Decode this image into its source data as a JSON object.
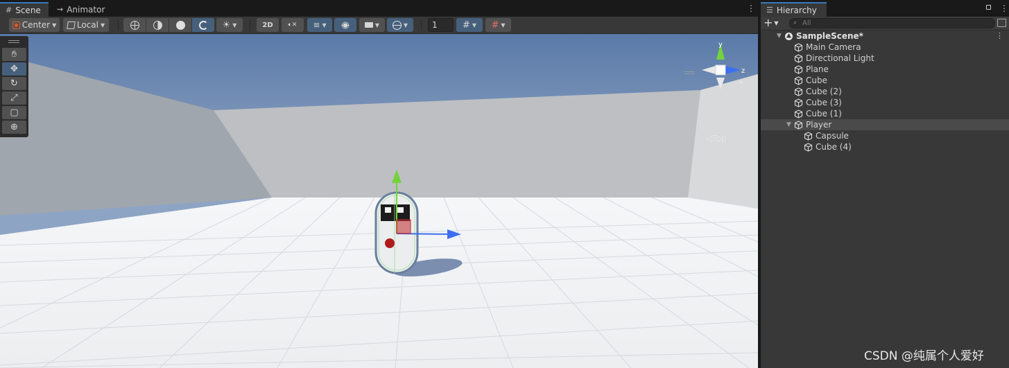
{
  "scene_tabs": {
    "scene_label": "Scene",
    "animator_label": "Animator",
    "menu_glyph": "⋮"
  },
  "hierarchy_tab": {
    "label": "Hierarchy",
    "menu_glyph": "⋮"
  },
  "toolbar": {
    "pivot_label": "Center",
    "space_label": "Local",
    "mode_2d_label": "2D",
    "grid_size_value": "1"
  },
  "tools": [
    "hand-tool",
    "move-tool",
    "rotate-tool",
    "scale-tool",
    "rect-tool",
    "transform-tool"
  ],
  "gizmo": {
    "y_label": "y",
    "z_label": "z",
    "view_label": "Top"
  },
  "hierarchy": {
    "search_placeholder": "All",
    "items": [
      {
        "label": "SampleScene*",
        "depth": 0,
        "expanded": true,
        "is_scene": true
      },
      {
        "label": "Main Camera",
        "depth": 1
      },
      {
        "label": "Directional Light",
        "depth": 1
      },
      {
        "label": "Plane",
        "depth": 1
      },
      {
        "label": "Cube",
        "depth": 1
      },
      {
        "label": "Cube (2)",
        "depth": 1
      },
      {
        "label": "Cube (3)",
        "depth": 1
      },
      {
        "label": "Cube (1)",
        "depth": 1
      },
      {
        "label": "Player",
        "depth": 1,
        "expanded": true,
        "selected": true
      },
      {
        "label": "Capsule",
        "depth": 2
      },
      {
        "label": "Cube (4)",
        "depth": 2
      }
    ]
  },
  "colors": {
    "accent": "#3a79bb",
    "active_button": "#46607c",
    "gizmo_x": "#c1282b",
    "gizmo_y": "#74d339",
    "gizmo_z": "#3c6ef0"
  },
  "watermark": "CSDN @纯属个人爱好"
}
